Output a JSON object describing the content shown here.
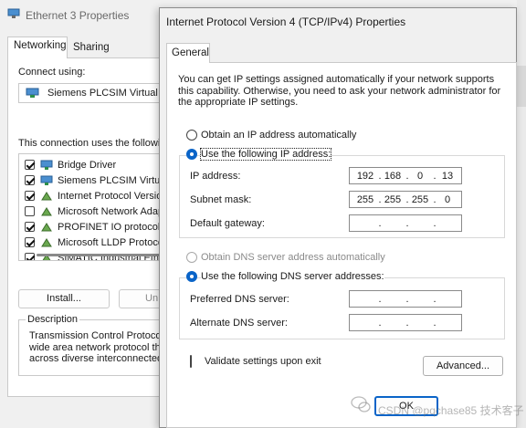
{
  "background_window": {
    "title": "Ethernet 3 Properties",
    "tabs": [
      "Networking",
      "Sharing"
    ],
    "connect_using_label": "Connect using:",
    "adapter_name": "Siemens PLCSIM Virtual E",
    "connection_uses_label": "This connection uses the followi",
    "items": [
      {
        "label": "Bridge Driver",
        "checked": true
      },
      {
        "label": "Siemens PLCSIM Virtua",
        "checked": true
      },
      {
        "label": "Internet Protocol Versio",
        "checked": true
      },
      {
        "label": "Microsoft Network Adap",
        "checked": false
      },
      {
        "label": "PROFINET IO protocol",
        "checked": true
      },
      {
        "label": "Microsoft LLDP Protoco",
        "checked": true
      },
      {
        "label": "SIMATIC Industrial Ethe",
        "checked": true
      }
    ],
    "install_label": "Install...",
    "uninstall_label": "Un",
    "description_label": "Description",
    "description_lines": [
      "Transmission Control Protocol",
      "wide area network protocol th",
      "across diverse interconnected"
    ]
  },
  "dialog": {
    "title": "Internet Protocol Version 4 (TCP/IPv4) Properties",
    "tab_general": "General",
    "intro_text": "You can get IP settings assigned automatically if your network supports this capability. Otherwise, you need to ask your network administrator for the appropriate IP settings.",
    "radio_auto_ip": "Obtain an IP address automatically",
    "radio_manual_ip": "Use the following IP address:",
    "ip_address_label": "IP address:",
    "ip_address": [
      "192",
      "168",
      "0",
      "13"
    ],
    "subnet_label": "Subnet mask:",
    "subnet_mask": [
      "255",
      "255",
      "255",
      "0"
    ],
    "gateway_label": "Default gateway:",
    "gateway": [
      "",
      "",
      "",
      ""
    ],
    "radio_auto_dns": "Obtain DNS server address automatically",
    "radio_manual_dns": "Use the following DNS server addresses:",
    "preferred_dns_label": "Preferred DNS server:",
    "alternate_dns_label": "Alternate DNS server:",
    "validate_label": "Validate settings upon exit",
    "advanced_label": "Advanced...",
    "ok_label": "OK"
  },
  "watermark": "CSDN @pqchase85 技术客子",
  "colors": {
    "accent": "#0a64c8"
  }
}
